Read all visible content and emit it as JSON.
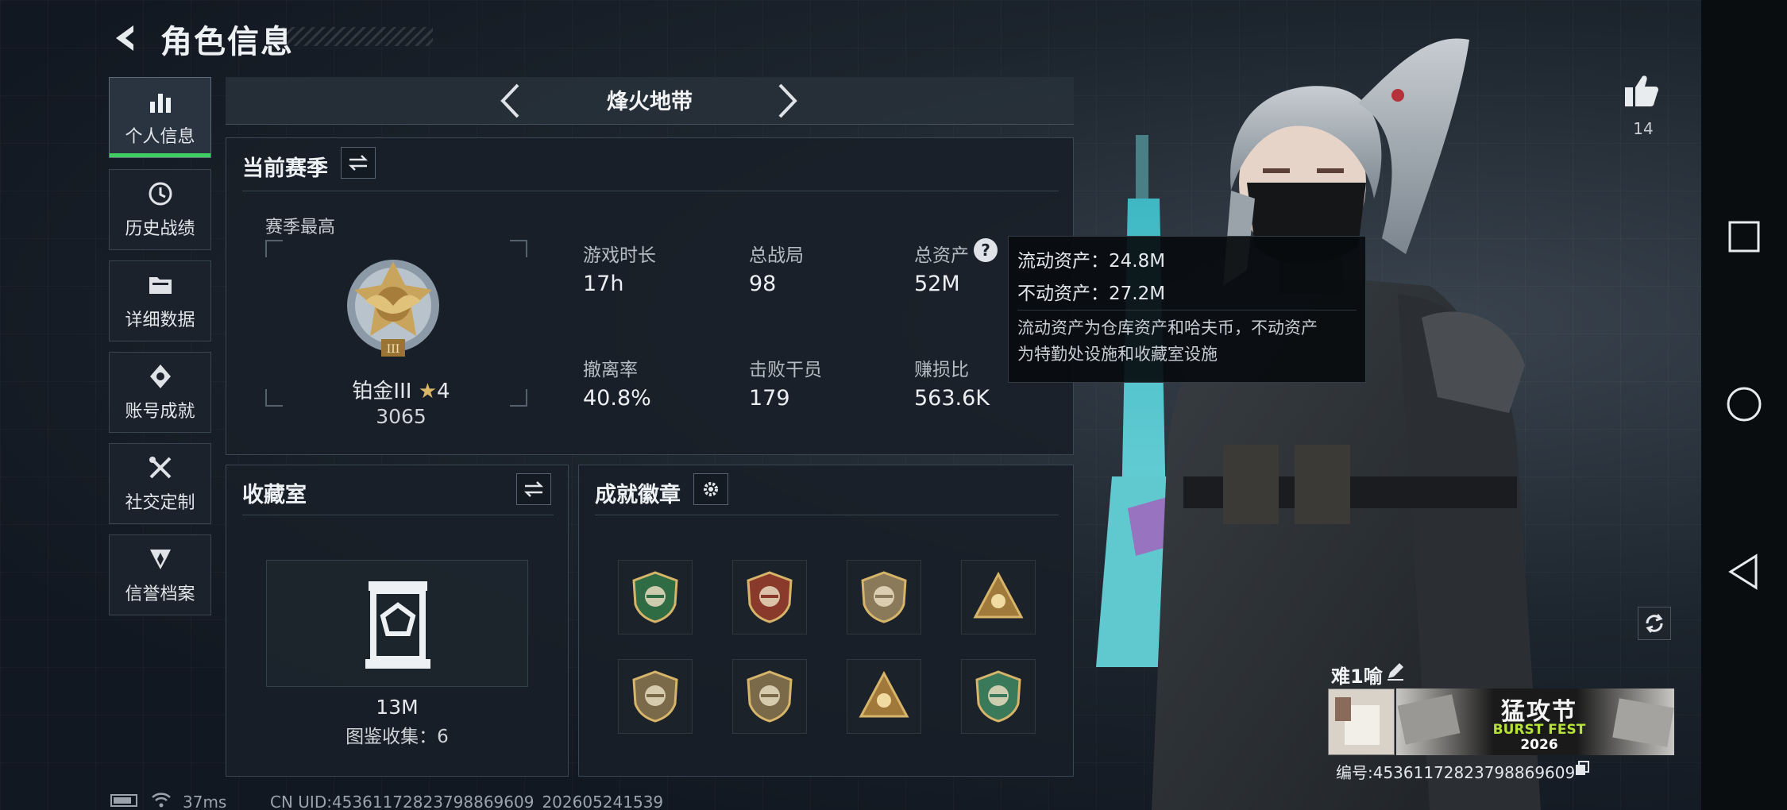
{
  "header": {
    "title": "角色信息"
  },
  "sidebar": {
    "items": [
      {
        "label": "个人信息",
        "icon": "bar-chart-icon",
        "active": true
      },
      {
        "label": "历史战绩",
        "icon": "history-icon"
      },
      {
        "label": "详细数据",
        "icon": "folder-icon"
      },
      {
        "label": "账号成就",
        "icon": "achievement-icon"
      },
      {
        "label": "社交定制",
        "icon": "tools-icon"
      },
      {
        "label": "信誉档案",
        "icon": "reputation-icon"
      }
    ]
  },
  "mode_nav": {
    "title": "烽火地带"
  },
  "season": {
    "title": "当前赛季",
    "best_label": "赛季最高",
    "rank_name": "铂金III",
    "rank_stars": "4",
    "rank_score": "3065",
    "stats": [
      {
        "label": "游戏时长",
        "value": "17h"
      },
      {
        "label": "总战局",
        "value": "98"
      },
      {
        "label": "总资产",
        "value": "52M"
      },
      {
        "label": "撤离率",
        "value": "40.8%"
      },
      {
        "label": "击败干员",
        "value": "179"
      },
      {
        "label": "赚损比",
        "value": "563.6K"
      }
    ]
  },
  "tooltip": {
    "liquid": "流动资产：24.8M",
    "fixed": "不动资产：27.2M",
    "desc_line1": "流动资产为仓库资产和哈夫币，不动资产",
    "desc_line2": "为特勤处设施和收藏室设施"
  },
  "collection": {
    "title": "收藏室",
    "value": "13M",
    "catalog": "图鉴收集：6"
  },
  "badges": {
    "title": "成就徽章",
    "items": [
      {
        "icon": "green-rifle-badge-icon",
        "color": "#2f6b43"
      },
      {
        "icon": "star-medal-badge-icon",
        "color": "#8a3a2a"
      },
      {
        "icon": "shield-badge-icon",
        "color": "#8a7a5a"
      },
      {
        "icon": "soldiers-badge-icon",
        "color": "#a07a3a"
      },
      {
        "icon": "pistol-badge-icon",
        "color": "#7a6a4a"
      },
      {
        "icon": "knife-badge-icon",
        "color": "#7a6a4a"
      },
      {
        "icon": "helmet-badge-icon",
        "color": "#a0783a"
      },
      {
        "icon": "skull-badge-icon",
        "color": "#3a7a5a"
      }
    ]
  },
  "likes": {
    "count": "14"
  },
  "player": {
    "name": "难1喻",
    "banner_title": "猛攻节",
    "banner_sub": "BURST FEST",
    "banner_year": "2026",
    "id_text": "编号:4536117282379886960​9"
  },
  "footer": {
    "ping": "37ms",
    "uid": "CN UID:4536117282379886960​9_202605241539"
  },
  "colors": {
    "accent": "#3ecf63",
    "gold": "#c9a45c"
  }
}
